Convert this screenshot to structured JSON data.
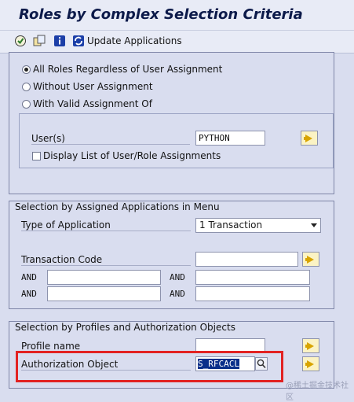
{
  "window": {
    "title": "Roles by Complex Selection Criteria"
  },
  "toolbar": {
    "icons": [
      "execute-icon",
      "copy-icon",
      "info-icon",
      "refresh-icon"
    ],
    "update_label": "Update Applications"
  },
  "user_assignment": {
    "options": [
      {
        "label": "All Roles Regardless of User Assignment",
        "selected": true
      },
      {
        "label": "Without User Assignment",
        "selected": false
      },
      {
        "label": "With Valid Assignment Of",
        "selected": false
      }
    ],
    "users_label": "User(s)",
    "users_value": "PYTHON",
    "display_list_label": "Display List of User/Role Assignments",
    "display_list_checked": false
  },
  "applications": {
    "title": "Selection by Assigned Applications in Menu",
    "type_label": "Type of Application",
    "type_value": "1 Transaction",
    "tcode_label": "Transaction Code",
    "tcode_value": "",
    "and_label": "AND"
  },
  "profiles": {
    "title": "Selection by Profiles and Authorization Objects",
    "profile_label": "Profile name",
    "profile_value": "",
    "authobj_label": "Authorization Object",
    "authobj_value": "S_RFCACL"
  },
  "watermark": "@稀土掘金技术社区",
  "colors": {
    "highlight": "#e22222",
    "selection": "#0a2f8a",
    "accent_button": "#fbf3c4"
  }
}
